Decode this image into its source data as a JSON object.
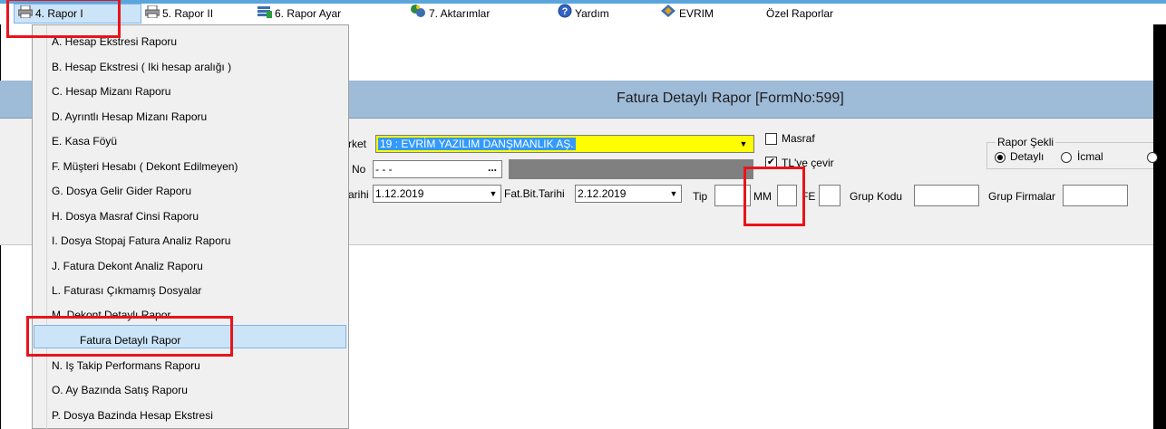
{
  "menu": {
    "items": [
      {
        "label": "4.  Rapor I",
        "icon": "printer-icon"
      },
      {
        "label": "5.  Rapor II",
        "icon": "printer-icon"
      },
      {
        "label": "6.  Rapor Ayar",
        "icon": "settings-icon"
      },
      {
        "label": "7.  Aktarımlar",
        "icon": "transfer-icon"
      },
      {
        "label": "Yardım",
        "icon": "help-icon"
      },
      {
        "label": "EVRIM",
        "icon": "evrim-icon"
      },
      {
        "label": "Özel Raporlar",
        "icon": ""
      }
    ]
  },
  "dropdown": {
    "items": [
      "A.  Hesap Ekstresi Raporu",
      "B.  Hesap Ekstresi ( Iki hesap aralığı )",
      "C.  Hesap Mizanı Raporu",
      "D.  Ayrıntlı Hesap Mizanı Raporu",
      "E.  Kasa Föyü",
      "F.  Müşteri Hesabı ( Dekont Edilmeyen)",
      "G.  Dosya Gelir Gider Raporu",
      "H.  Dosya Masraf Cinsi Raporu",
      "I.  Dosya Stopaj Fatura Analiz Raporu",
      "J.  Fatura Dekont Analiz Raporu",
      "L.  Faturası Çıkmamış Dosyalar",
      "M.  Dekont Detaylı Rapor",
      "Fatura Detaylı Rapor",
      "N.  Iş Takip Performans Raporu",
      "O.  Ay Bazında Satış Raporu",
      "P.  Dosya Bazinda Hesap Ekstresi"
    ],
    "highlighted_index": 12
  },
  "form": {
    "title": "Fatura Detaylı Rapor [FormNo:599]",
    "firma_label": "rket",
    "firma_value": "19 : EVRİM YAZILIM DANŞMANLIK AŞ.",
    "no_label": "No",
    "no_value": "  -    -  -",
    "tarih_label": "arihi",
    "tarih_value": "1.12.2019",
    "fat_bit_label": "Fat.Bit.Tarihi",
    "fat_bit_value": "2.12.2019",
    "tip_label": "Tip",
    "tip_value": "",
    "mm_label": "MM",
    "mm_value": "",
    "fe_label": "FE",
    "fe_value": "",
    "grup_kodu_label": "Grup Kodu",
    "grup_kodu_value": "",
    "grup_firmalar_label": "Grup Firmalar",
    "grup_firmalar_value": "",
    "masraf_label": "Masraf",
    "masraf_checked": false,
    "tl_cevir_label": "TL'ye çevir",
    "tl_cevir_checked": true,
    "rapor_sekli_label": "Rapor Şekli",
    "rapor_sekli_options": [
      "Detaylı",
      "İcmal"
    ],
    "rapor_sekli_selected": "Detaylı"
  }
}
